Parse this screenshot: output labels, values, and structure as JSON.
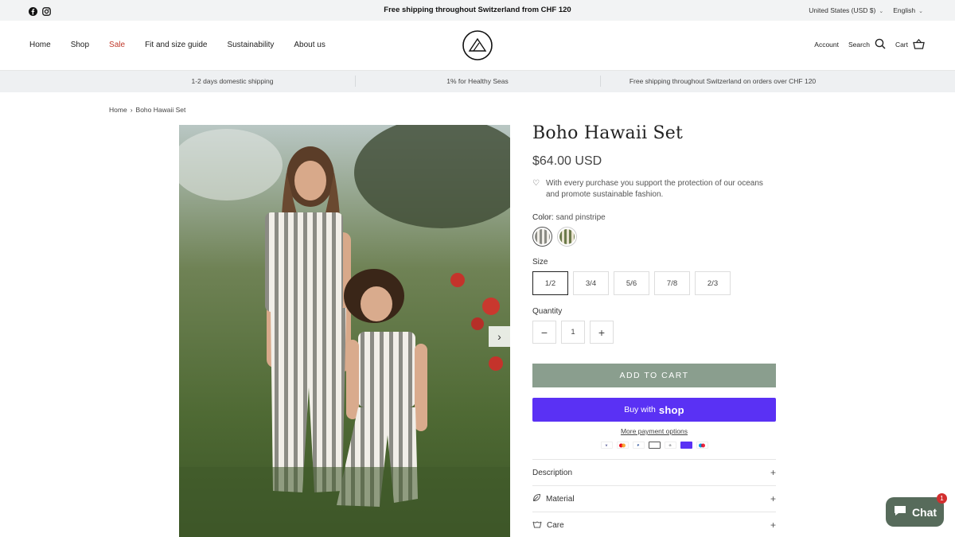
{
  "announcement": {
    "text": "Free shipping throughout Switzerland from CHF 120",
    "currency": "United States (USD $)",
    "language": "English",
    "social": [
      "facebook-icon",
      "instagram-icon"
    ]
  },
  "header": {
    "nav": [
      "Home",
      "Shop",
      "Sale",
      "Fit and size guide",
      "Sustainability",
      "About us"
    ],
    "account": "Account",
    "search": "Search",
    "cart": "Cart"
  },
  "usp": [
    "1-2 days domestic shipping",
    "1% for Healthy Seas",
    "Free shipping throughout Switzerland on orders over CHF 120"
  ],
  "breadcrumb": {
    "home": "Home",
    "separator": "›",
    "current": "Boho Hawaii Set"
  },
  "product": {
    "title": "Boho Hawaii Set",
    "price": "$64.00 USD",
    "notice": "With every purchase you support the protection of our oceans and promote sustainable fashion.",
    "color_label": "Color:",
    "color_value": "sand pinstripe",
    "size_label": "Size",
    "sizes": [
      "1/2",
      "3/4",
      "5/6",
      "7/8",
      "2/3"
    ],
    "selected_size": "1/2",
    "quantity_label": "Quantity",
    "quantity": "1",
    "add_to_cart": "ADD TO CART",
    "buy_with": "Buy with",
    "buy_brand": "shop",
    "more_payment": "More payment options",
    "accordion": [
      "Description",
      "Material",
      "Care"
    ]
  },
  "chat": {
    "label": "Chat",
    "badge": "1"
  },
  "colors": {
    "sale": "#c0392b",
    "add_to_cart_bg": "#8a9e8e",
    "shop_pay_bg": "#5a31f4",
    "chat_bg": "#576b5b"
  }
}
